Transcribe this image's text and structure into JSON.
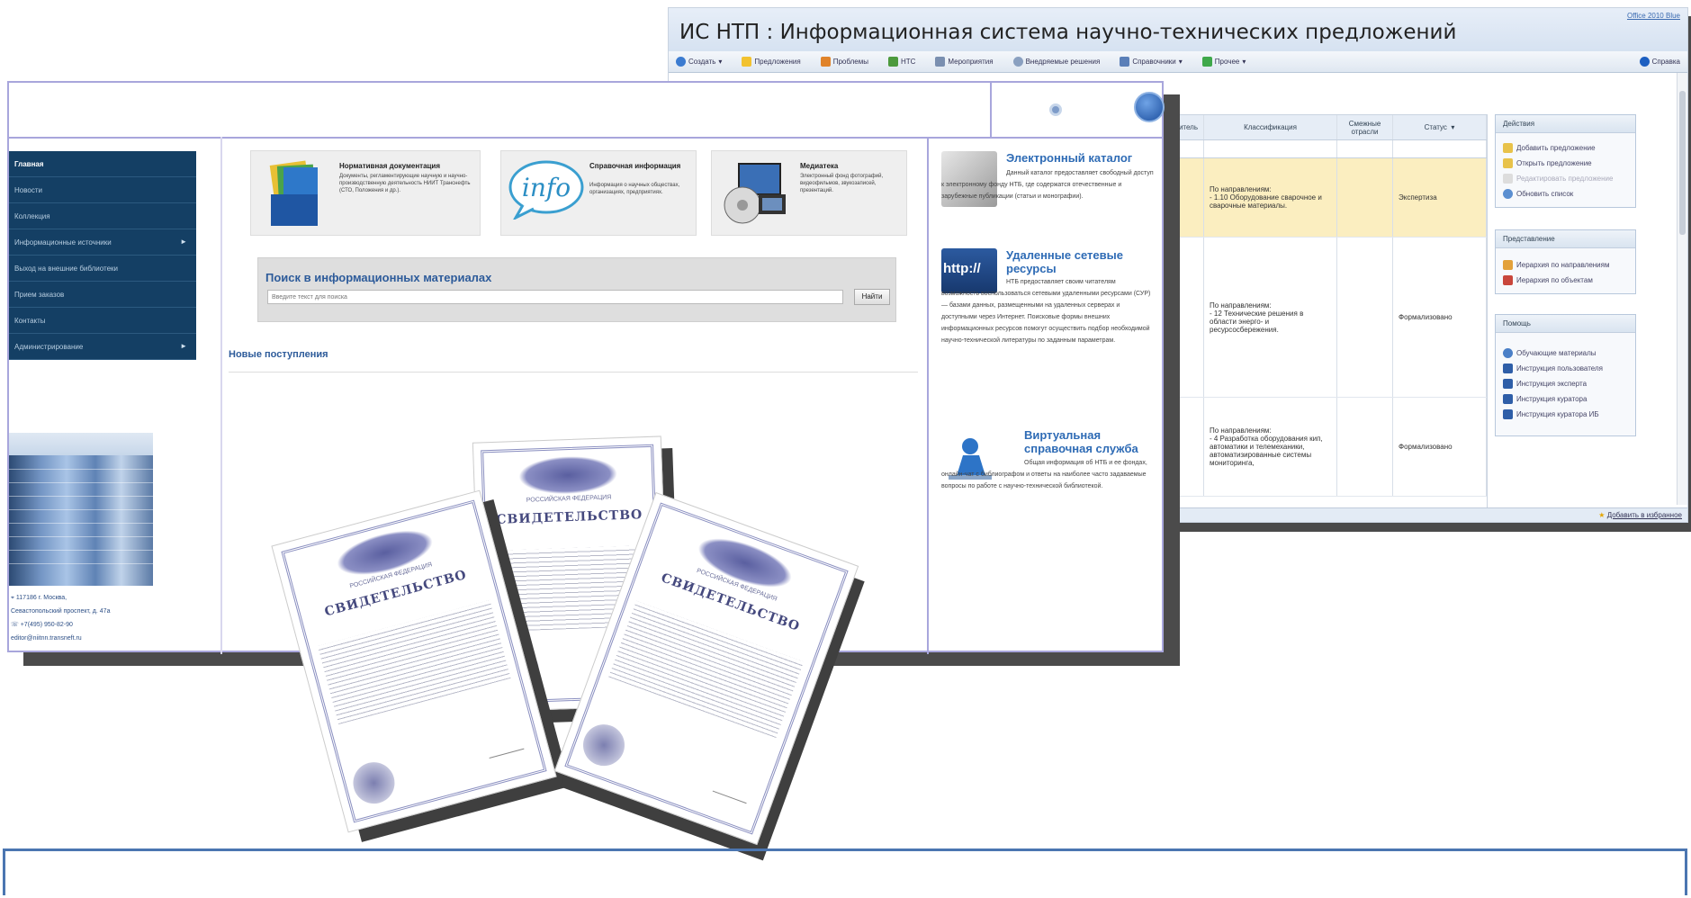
{
  "ntp_window": {
    "title": "ИС НТП : Информационная система научно-технических предложений",
    "theme_link": "Office 2010 Blue",
    "toolbar": [
      {
        "label": "Создать",
        "icon": "plus-icon",
        "dropdown": true
      },
      {
        "label": "Предложения",
        "icon": "bulb-icon",
        "dropdown": false
      },
      {
        "label": "Проблемы",
        "icon": "warning-icon",
        "dropdown": false
      },
      {
        "label": "НТС",
        "icon": "people-icon",
        "dropdown": false
      },
      {
        "label": "Мероприятия",
        "icon": "calendar-icon",
        "dropdown": false
      },
      {
        "label": "Внедряемые решения",
        "icon": "gear-icon",
        "dropdown": false
      },
      {
        "label": "Справочники",
        "icon": "book-icon",
        "dropdown": true
      },
      {
        "label": "Прочее",
        "icon": "cross-icon",
        "dropdown": true
      }
    ],
    "help_label": "Справка",
    "table": {
      "headers": [
        "ние / итель",
        "Классификация",
        "Смежные отрасли",
        "Статус"
      ],
      "rows": [
        {
          "classification": "По направлениям:\n- 1.10 Оборудование сварочное и сварочные материалы.",
          "status": "Экспертиза",
          "highlight": true
        },
        {
          "classification": "По направлениям:\n- 12 Технические решения в области энерго- и ресурсосбережения.",
          "status": "Формализовано",
          "highlight": false
        },
        {
          "classification": "По направлениям:\n- 4 Разработка оборудования кип, автоматики и телемеханики, автоматизированные системы мониторинга,",
          "status": "Формализовано",
          "highlight": false
        }
      ]
    },
    "panels": [
      {
        "title": "Действия",
        "items": [
          "Добавить предложение",
          "Открыть предложение",
          "Редактировать предложение",
          "Обновить список"
        ]
      },
      {
        "title": "Представление",
        "items": [
          "Иерархия по направлениям",
          "Иерархия по объектам"
        ]
      },
      {
        "title": "Помощь",
        "items": [
          "Обучающие материалы",
          "Инструкция пользователя",
          "Инструкция эксперта",
          "Инструкция куратора",
          "Инструкция куратора ИБ"
        ]
      }
    ],
    "status_bar": "Добавить в избранное"
  },
  "library_window": {
    "nav": [
      {
        "label": "Главная",
        "active": true,
        "submenu": false
      },
      {
        "label": "Новости",
        "active": false,
        "submenu": false
      },
      {
        "label": "Коллекция",
        "active": false,
        "submenu": false
      },
      {
        "label": "Информационные источники",
        "active": false,
        "submenu": true
      },
      {
        "label": "Выход на внешние библиотеки",
        "active": false,
        "submenu": false
      },
      {
        "label": "Прием заказов",
        "active": false,
        "submenu": false
      },
      {
        "label": "Контакты",
        "active": false,
        "submenu": false
      },
      {
        "label": "Администрирование",
        "active": false,
        "submenu": true
      }
    ],
    "contacts": {
      "address1": "117186 г. Москва,",
      "address2": "Севастопольский проспект, д. 47а",
      "phone": "+7(495) 950-82-90",
      "email": "editor@niitnn.transneft.ru"
    },
    "tiles": [
      {
        "title": "Нормативная документация",
        "text": "Документы, регламентирующие научную и научно-производственную деятельность НИИТ Транснефть (СТО, Положения и др.)."
      },
      {
        "title": "Справочная информация",
        "text": "Информация о научных обществах, организациях, предприятиях.",
        "logo": "info"
      },
      {
        "title": "Медиатека",
        "text": "Электронный фонд фотографий, видеофильмов, звукозаписей, презентаций."
      }
    ],
    "search": {
      "title": "Поиск в информационных материалах",
      "placeholder": "Введите текст для поиска",
      "button": "Найти"
    },
    "new_arrivals_title": "Новые поступления",
    "right_blocks": [
      {
        "title": "Электронный каталог",
        "text": "Данный каталог предоставляет свободный доступ к электронному фонду НТБ, где содержатся отечественные и зарубежные публикации (статьи и монографии)."
      },
      {
        "title": "Удаленные сетевые ресурсы",
        "text": "НТБ предоставляет своим читателям возможность воспользоваться сетевыми удаленными ресурсами (СУР) — базами данных, размещенными на удаленных серверах и доступными через Интернет. Поисковые формы внешних информационных ресурсов помогут осуществить подбор необходимой научно-технической литературы по заданным параметрам.",
        "icon_text": "http://"
      },
      {
        "title": "Виртуальная справочная служба",
        "text": "Общая информация об НТБ и ее фондах, онлайн-чат с библиографом и ответы на наиболее часто задаваемые вопросы по работе с научно-технической библиотекой."
      }
    ]
  },
  "certificates": [
    {
      "header": "РОССИЙСКАЯ ФЕДЕРАЦИЯ",
      "title": "СВИДЕТЕЛЬСТВО"
    },
    {
      "header": "РОССИЙСКАЯ ФЕДЕРАЦИЯ",
      "title": "СВИДЕТЕЛЬСТВО"
    },
    {
      "header": "РОССИЙСКАЯ ФЕДЕРАЦИЯ",
      "title": "СВИДЕТЕЛЬСТВО"
    }
  ]
}
